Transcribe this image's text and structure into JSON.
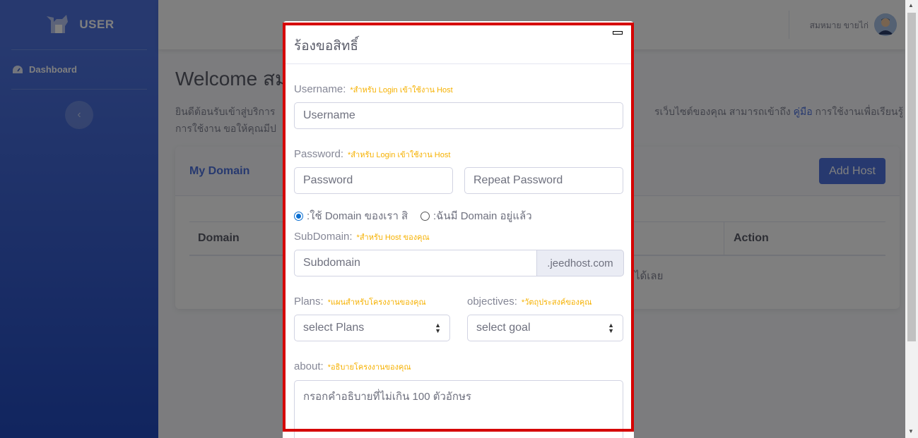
{
  "sidebar": {
    "brand": "USER",
    "items": [
      {
        "label": "Dashboard"
      }
    ],
    "toggle_glyph": "‹"
  },
  "topbar": {
    "user_name": "สมหมาย ขายไก่"
  },
  "page": {
    "welcome": "Welcome สม",
    "intro_line1_left": "ยินดีต้อนรับเข้าสู่บริการ",
    "intro_line1_right": "รเว็บไซต์ของคุณ สามารถเข้าถึง ",
    "intro_link": "คู่มือ",
    "intro_line1_end": " การใช้งานเพื่อเรียนรู้",
    "intro_line2": "การใช้งาน ขอให้คุณมีป"
  },
  "card": {
    "title": "My Domain",
    "add_button": "Add Host",
    "columns": [
      "Domain",
      "Action"
    ],
    "empty_fragment": "ได้เลย"
  },
  "modal": {
    "title": "ร้องขอสิทธิ์",
    "username": {
      "label": "Username:",
      "note": "*สำหรับ Login เข้าใช้งาน Host",
      "placeholder": "Username"
    },
    "password": {
      "label": "Password:",
      "note": "*สำหรับ Login เข้าใช้งาน Host",
      "placeholder": "Password",
      "repeat_placeholder": "Repeat Password"
    },
    "domain_options": [
      {
        "label": ":ใช้ Domain ของเรา สิ",
        "checked": true
      },
      {
        "label": ":ฉันมี Domain อยู่แล้ว",
        "checked": false
      }
    ],
    "subdomain": {
      "label": "SubDomain:",
      "note": "*สำหรับ Host ของคุณ",
      "placeholder": "Subdomain",
      "suffix": ".jeedhost.com"
    },
    "plans": {
      "label": "Plans:",
      "note": "*แผนสำหรับโครงงานของคุณ",
      "selected": "select Plans"
    },
    "objectives": {
      "label": "objectives:",
      "note": "*วัตถุประสงค์ของคุณ",
      "selected": "select goal"
    },
    "about": {
      "label": "about:",
      "note": "*อธิบายโครงงานของคุณ",
      "placeholder": "กรอกคำอธิบายที่ไม่เกิน 100 ตัวอักษร"
    }
  },
  "colors": {
    "primary": "#4e73df",
    "highlight": "#d50000",
    "note": "#f6b100"
  }
}
